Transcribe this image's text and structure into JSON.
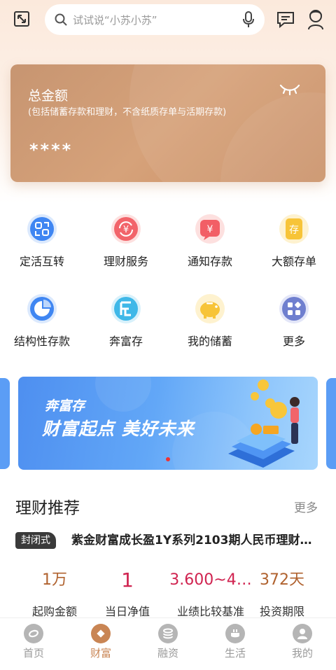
{
  "search": {
    "placeholder": "试试说“小苏小苏”"
  },
  "asset_card": {
    "title": "总金额",
    "subtitle": "(包括储蓄存款和理财，不含纸质存单与活期存款)",
    "amount_masked": "****"
  },
  "services": [
    {
      "label": "定活互转",
      "icon": "transfer-icon",
      "color": "#3f86f2"
    },
    {
      "label": "理财服务",
      "icon": "finance-service-icon",
      "color": "#f2646a"
    },
    {
      "label": "通知存款",
      "icon": "notice-deposit-icon",
      "color": "#f25f66"
    },
    {
      "label": "大额存单",
      "icon": "large-deposit-icon",
      "color": "#f7c438"
    },
    {
      "label": "结构性存款",
      "icon": "structured-deposit-icon",
      "color": "#3f86f2"
    },
    {
      "label": "奔富存",
      "icon": "benfu-icon",
      "color": "#3fb8e8"
    },
    {
      "label": "我的储蓄",
      "icon": "piggy-bank-icon",
      "color": "#f7c438"
    },
    {
      "label": "更多",
      "icon": "more-grid-icon",
      "color": "#6f7fcf"
    }
  ],
  "banner": {
    "small_text": "奔富存",
    "big_text": "财富起点 美好未来"
  },
  "finance": {
    "section_title": "理财推荐",
    "more_label": "更多",
    "product_tag": "封闭式",
    "product_name": "紫金财富成长盈1Y系列2103期人民币理财…",
    "stats": [
      {
        "value": "1万",
        "label": "起购金额",
        "color": "#b0622f"
      },
      {
        "value": "1",
        "label": "当日净值",
        "color": "#d02350"
      },
      {
        "value": "3.600~4…",
        "label": "业绩比较基准",
        "color": "#d02350"
      },
      {
        "value": "372天",
        "label": "投资期限",
        "color": "#b0622f"
      }
    ]
  },
  "bottom_nav": [
    {
      "label": "首页",
      "icon": "home-icon"
    },
    {
      "label": "财富",
      "icon": "wealth-icon",
      "active": true
    },
    {
      "label": "融资",
      "icon": "financing-icon"
    },
    {
      "label": "生活",
      "icon": "life-icon"
    },
    {
      "label": "我的",
      "icon": "profile-icon"
    }
  ]
}
